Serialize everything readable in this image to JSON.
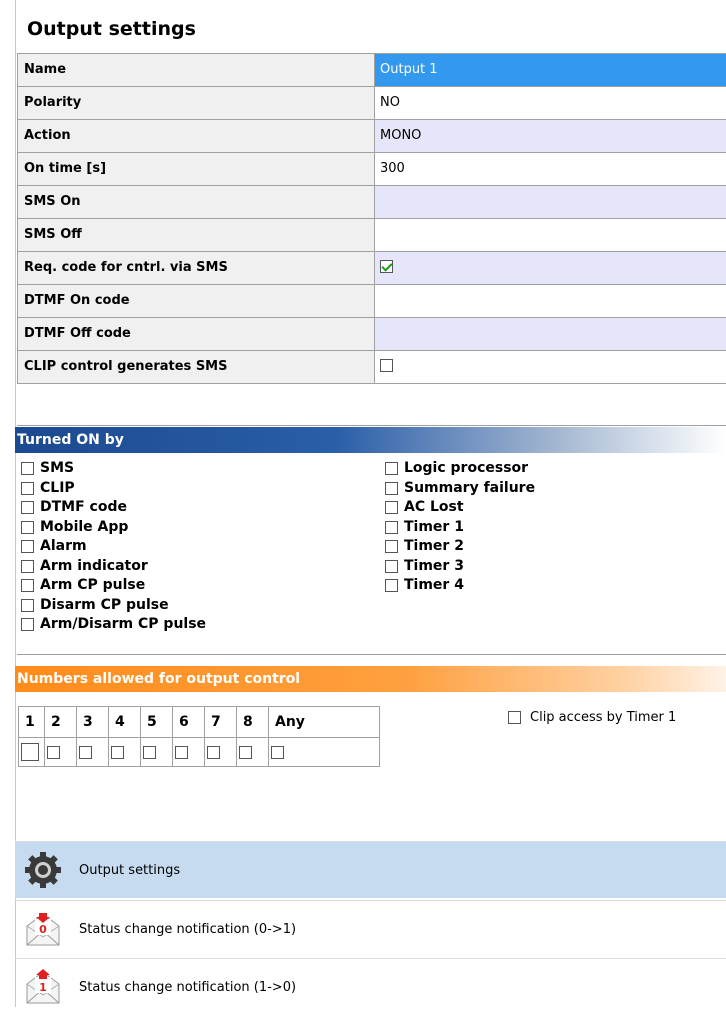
{
  "panel": {
    "title": "Output settings"
  },
  "settings": [
    {
      "label": "Name",
      "value": "Output 1",
      "selected": true
    },
    {
      "label": "Polarity",
      "value": "NO"
    },
    {
      "label": "Action",
      "value": "MONO"
    },
    {
      "label": "On time [s]",
      "value": "300"
    },
    {
      "label": "SMS On",
      "value": ""
    },
    {
      "label": "SMS Off",
      "value": ""
    },
    {
      "label": "Req. code for cntrl. via SMS",
      "checkbox": true,
      "checked": true
    },
    {
      "label": "DTMF On code",
      "value": ""
    },
    {
      "label": "DTMF Off code",
      "value": ""
    },
    {
      "label": "CLIP control generates SMS",
      "checkbox": true,
      "checked": false
    }
  ],
  "turned_on_by": {
    "title": "Turned ON by",
    "left": [
      "SMS",
      "CLIP",
      "DTMF code",
      "Mobile App",
      "Alarm",
      "Arm indicator",
      "Arm CP pulse",
      "Disarm CP pulse",
      "Arm/Disarm CP pulse"
    ],
    "right": [
      "Logic processor",
      "Summary failure",
      "AC Lost",
      "Timer 1",
      "Timer 2",
      "Timer 3",
      "Timer 4"
    ]
  },
  "numbers": {
    "title": "Numbers allowed for output control",
    "headers": [
      "1",
      "2",
      "3",
      "4",
      "5",
      "6",
      "7",
      "8",
      "Any"
    ],
    "clip_timer_label": "Clip access by Timer 1"
  },
  "nav": [
    {
      "label": "Output settings",
      "icon": "gear-icon",
      "active": true
    },
    {
      "label": "Status change notification (0->1)",
      "icon": "envelope-0-icon",
      "digit": "0"
    },
    {
      "label": "Status change notification (1->0)",
      "icon": "envelope-1-icon",
      "digit": "1"
    }
  ]
}
